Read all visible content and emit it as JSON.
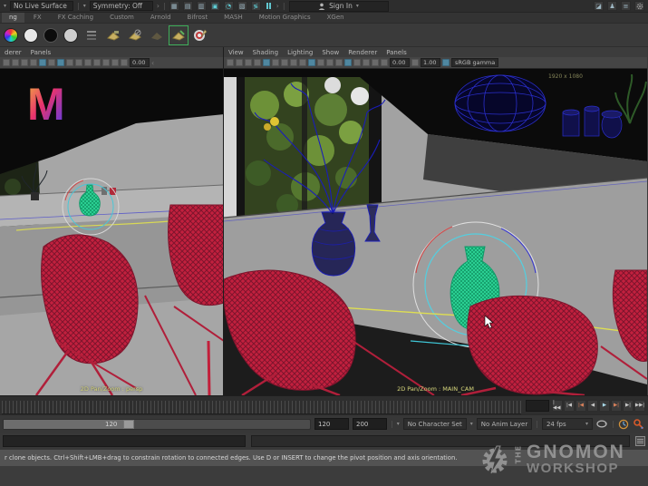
{
  "colors": {
    "wire_red": "#c2203e",
    "wire_blue": "#1f23b8",
    "selection_green": "#2fd89a",
    "manipulator_teal": "#53cfe0",
    "curve_yellow": "#dede52",
    "ui_accent_teal": "#4f87a0"
  },
  "top_bar": {
    "live_surface": "No Live Surface",
    "symmetry": "Symmetry: Off",
    "sign_in": "Sign In"
  },
  "shelf_tabs": [
    "ng",
    "FX",
    "FX Caching",
    "Custom",
    "Arnold",
    "Bifrost",
    "MASH",
    "Motion Graphics",
    "XGen"
  ],
  "left_viewport": {
    "menu": [
      "derer",
      "Panels"
    ],
    "exposure": "0.00",
    "label": "2D Pan/Zoom : persp"
  },
  "right_viewport": {
    "menu": [
      "View",
      "Shading",
      "Lighting",
      "Show",
      "Renderer",
      "Panels"
    ],
    "exposure": "0.00",
    "gamma": "1.00",
    "color_space": "sRGB gamma",
    "resolution": "1920 x 1080",
    "label": "2D Pan/Zoom : MAIN_CAM"
  },
  "playback": {
    "buttons": [
      "|◀◀",
      "|◀",
      "|◀",
      "◀",
      "▶",
      "▶|",
      "▶|",
      "▶▶|"
    ]
  },
  "range_slider": {
    "range_value": "120",
    "start": "120",
    "end": "200",
    "character_set": "No Character Set",
    "anim_layer": "No Anim Layer",
    "fps": "24 fps"
  },
  "help_line": "r clone objects. Ctrl+Shift+LMB+drag to constrain rotation to connected edges. Use D or INSERT to change the pivot position and axis orientation.",
  "watermark": {
    "the": "THE",
    "name": "GNOMON",
    "name2": "WORKSHOP"
  },
  "glyphs": {
    "caret_down": "▾",
    "chevron_right": "›",
    "pipe": "|"
  }
}
